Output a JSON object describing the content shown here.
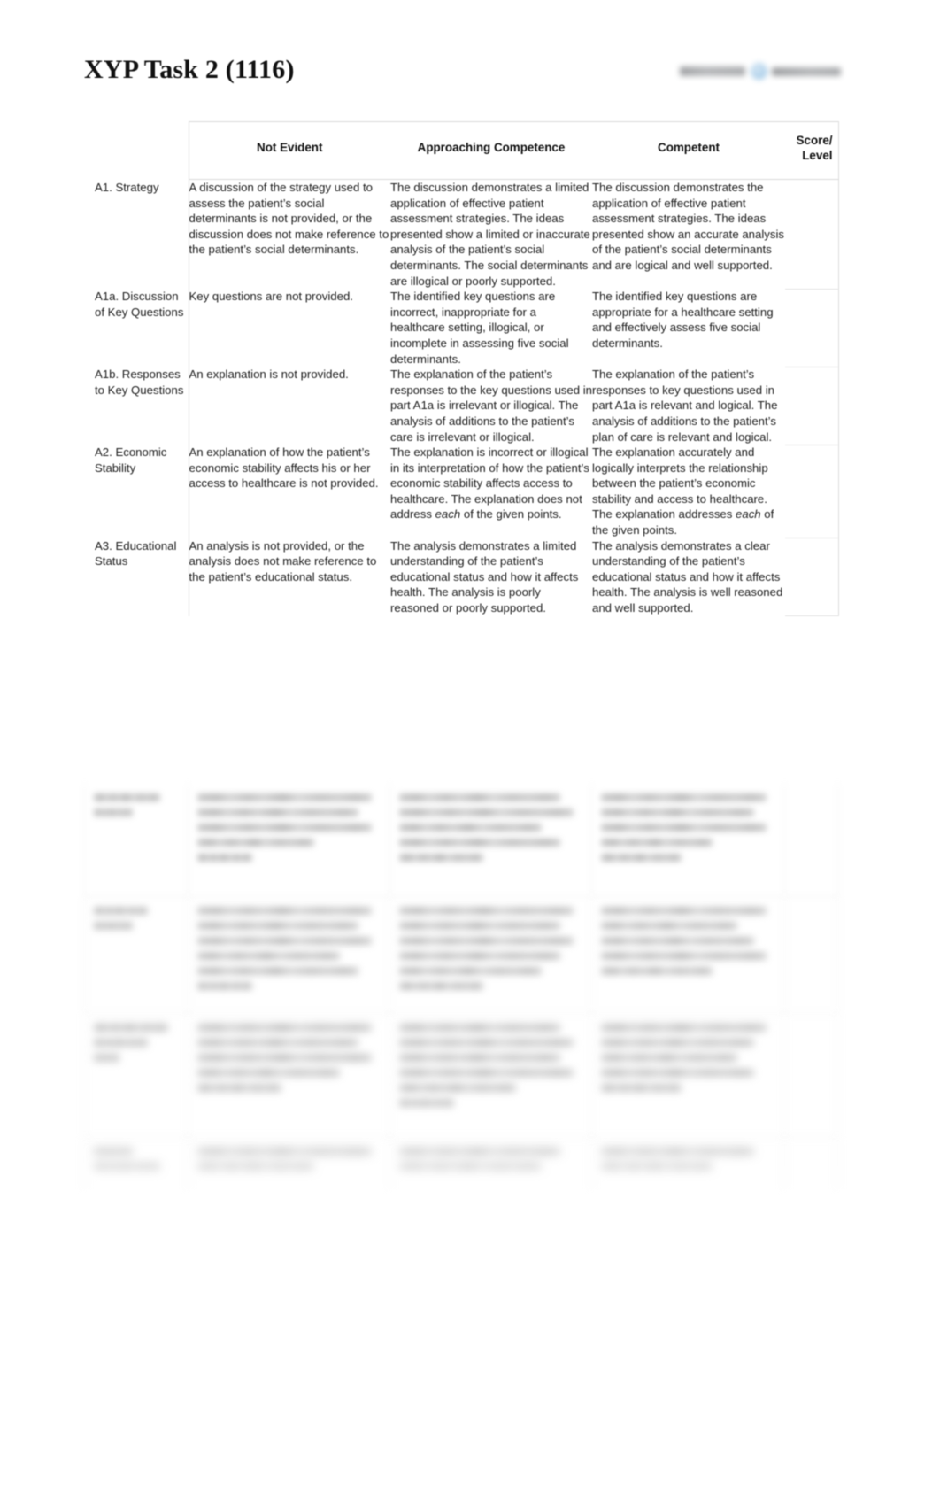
{
  "document": {
    "title": "XYP Task 2 (1116)",
    "logo": {
      "alt": "institution-logo",
      "accent_color": "#9ec7e6",
      "state": "blurred"
    }
  },
  "table": {
    "columns": [
      {
        "key": "criterion",
        "label": ""
      },
      {
        "key": "not_evident",
        "label": "Not Evident"
      },
      {
        "key": "approaching",
        "label": "Approaching Competence"
      },
      {
        "key": "competent",
        "label": "Competent"
      },
      {
        "key": "score",
        "label_line1": "Score/",
        "label_line2": "Level"
      }
    ],
    "rows": [
      {
        "criterion": "A1. Strategy",
        "not_evident": "A discussion of the strategy used to assess the patient’s social determinants is not provided, or the discussion does not make reference to the patient’s social determinants.",
        "approaching": "The discussion demonstrates a limited application of effective patient assessment strategies. The ideas presented show a limited or inaccurate analysis of the patient’s social determinants. The social determinants are illogical or poorly supported.",
        "competent": "The discussion demonstrates the application of effective patient assessment strategies. The ideas presented show an accurate analysis of the patient’s social determinants and are logical and well supported.",
        "score": ""
      },
      {
        "criterion": "A1a. Discussion of Key Questions",
        "not_evident": "Key questions are not provided.",
        "approaching": "The identified key questions are incorrect, inappropriate for a healthcare setting, illogical, or incomplete in assessing five social determinants.",
        "competent": "The identified key questions are appropriate for a healthcare setting and effectively assess five social determinants.",
        "score": ""
      },
      {
        "criterion": "A1b. Responses to Key Questions",
        "not_evident": "An explanation is not provided.",
        "approaching": "The explanation of the patient’s responses to the key questions used in part A1a is irrelevant or illogical. The analysis of additions to the patient’s care is irrelevant or illogical.",
        "competent": "The explanation of the patient’s responses to key questions used in part A1a is relevant and logical. The analysis of additions to the patient’s plan of care is relevant and logical.",
        "score": ""
      },
      {
        "criterion": "A2. Economic Stability",
        "not_evident": "An explanation of how the patient’s economic stability affects his or her access to healthcare is not provided.",
        "approaching_pre": "The explanation is incorrect or illogical in its interpretation of how the patient’s economic stability affects access to healthcare. The explanation does not address ",
        "approaching_em": "each",
        "approaching_post": " of the given points.",
        "competent_pre": "The explanation accurately and logically interprets the relationship between the patient’s economic stability and access to healthcare. The explanation addresses ",
        "competent_em": "each",
        "competent_post": " of the given points.",
        "score": ""
      },
      {
        "criterion": "A3. Educational Status",
        "not_evident": "An analysis is not provided, or the analysis does not make reference to the patient’s educational status.",
        "approaching": "The analysis demonstrates a limited understanding of the patient’s educational status and how it affects health. The analysis is poorly reasoned or poorly supported.",
        "competent": "The analysis demonstrates a clear understanding of the patient’s educational status and how it affects health. The analysis is well reasoned and well supported.",
        "score": ""
      }
    ],
    "redacted_rows_note": "4 additional rubric rows below are blurred and illegible in the screenshot"
  }
}
